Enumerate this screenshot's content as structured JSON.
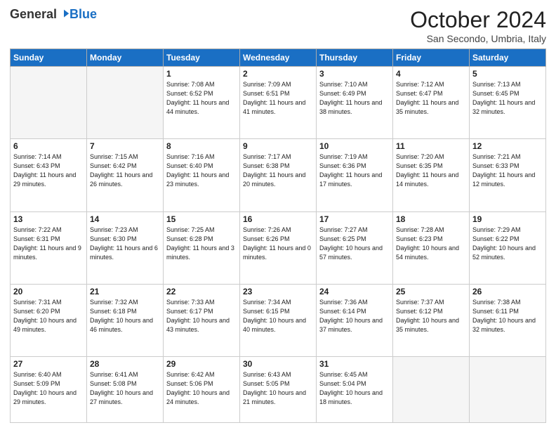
{
  "header": {
    "logo": {
      "general": "General",
      "blue": "Blue"
    },
    "title": "October 2024",
    "subtitle": "San Secondo, Umbria, Italy"
  },
  "weekdays": [
    "Sunday",
    "Monday",
    "Tuesday",
    "Wednesday",
    "Thursday",
    "Friday",
    "Saturday"
  ],
  "weeks": [
    [
      {
        "day": "",
        "info": ""
      },
      {
        "day": "",
        "info": ""
      },
      {
        "day": "1",
        "info": "Sunrise: 7:08 AM\nSunset: 6:52 PM\nDaylight: 11 hours and 44 minutes."
      },
      {
        "day": "2",
        "info": "Sunrise: 7:09 AM\nSunset: 6:51 PM\nDaylight: 11 hours and 41 minutes."
      },
      {
        "day": "3",
        "info": "Sunrise: 7:10 AM\nSunset: 6:49 PM\nDaylight: 11 hours and 38 minutes."
      },
      {
        "day": "4",
        "info": "Sunrise: 7:12 AM\nSunset: 6:47 PM\nDaylight: 11 hours and 35 minutes."
      },
      {
        "day": "5",
        "info": "Sunrise: 7:13 AM\nSunset: 6:45 PM\nDaylight: 11 hours and 32 minutes."
      }
    ],
    [
      {
        "day": "6",
        "info": "Sunrise: 7:14 AM\nSunset: 6:43 PM\nDaylight: 11 hours and 29 minutes."
      },
      {
        "day": "7",
        "info": "Sunrise: 7:15 AM\nSunset: 6:42 PM\nDaylight: 11 hours and 26 minutes."
      },
      {
        "day": "8",
        "info": "Sunrise: 7:16 AM\nSunset: 6:40 PM\nDaylight: 11 hours and 23 minutes."
      },
      {
        "day": "9",
        "info": "Sunrise: 7:17 AM\nSunset: 6:38 PM\nDaylight: 11 hours and 20 minutes."
      },
      {
        "day": "10",
        "info": "Sunrise: 7:19 AM\nSunset: 6:36 PM\nDaylight: 11 hours and 17 minutes."
      },
      {
        "day": "11",
        "info": "Sunrise: 7:20 AM\nSunset: 6:35 PM\nDaylight: 11 hours and 14 minutes."
      },
      {
        "day": "12",
        "info": "Sunrise: 7:21 AM\nSunset: 6:33 PM\nDaylight: 11 hours and 12 minutes."
      }
    ],
    [
      {
        "day": "13",
        "info": "Sunrise: 7:22 AM\nSunset: 6:31 PM\nDaylight: 11 hours and 9 minutes."
      },
      {
        "day": "14",
        "info": "Sunrise: 7:23 AM\nSunset: 6:30 PM\nDaylight: 11 hours and 6 minutes."
      },
      {
        "day": "15",
        "info": "Sunrise: 7:25 AM\nSunset: 6:28 PM\nDaylight: 11 hours and 3 minutes."
      },
      {
        "day": "16",
        "info": "Sunrise: 7:26 AM\nSunset: 6:26 PM\nDaylight: 11 hours and 0 minutes."
      },
      {
        "day": "17",
        "info": "Sunrise: 7:27 AM\nSunset: 6:25 PM\nDaylight: 10 hours and 57 minutes."
      },
      {
        "day": "18",
        "info": "Sunrise: 7:28 AM\nSunset: 6:23 PM\nDaylight: 10 hours and 54 minutes."
      },
      {
        "day": "19",
        "info": "Sunrise: 7:29 AM\nSunset: 6:22 PM\nDaylight: 10 hours and 52 minutes."
      }
    ],
    [
      {
        "day": "20",
        "info": "Sunrise: 7:31 AM\nSunset: 6:20 PM\nDaylight: 10 hours and 49 minutes."
      },
      {
        "day": "21",
        "info": "Sunrise: 7:32 AM\nSunset: 6:18 PM\nDaylight: 10 hours and 46 minutes."
      },
      {
        "day": "22",
        "info": "Sunrise: 7:33 AM\nSunset: 6:17 PM\nDaylight: 10 hours and 43 minutes."
      },
      {
        "day": "23",
        "info": "Sunrise: 7:34 AM\nSunset: 6:15 PM\nDaylight: 10 hours and 40 minutes."
      },
      {
        "day": "24",
        "info": "Sunrise: 7:36 AM\nSunset: 6:14 PM\nDaylight: 10 hours and 37 minutes."
      },
      {
        "day": "25",
        "info": "Sunrise: 7:37 AM\nSunset: 6:12 PM\nDaylight: 10 hours and 35 minutes."
      },
      {
        "day": "26",
        "info": "Sunrise: 7:38 AM\nSunset: 6:11 PM\nDaylight: 10 hours and 32 minutes."
      }
    ],
    [
      {
        "day": "27",
        "info": "Sunrise: 6:40 AM\nSunset: 5:09 PM\nDaylight: 10 hours and 29 minutes."
      },
      {
        "day": "28",
        "info": "Sunrise: 6:41 AM\nSunset: 5:08 PM\nDaylight: 10 hours and 27 minutes."
      },
      {
        "day": "29",
        "info": "Sunrise: 6:42 AM\nSunset: 5:06 PM\nDaylight: 10 hours and 24 minutes."
      },
      {
        "day": "30",
        "info": "Sunrise: 6:43 AM\nSunset: 5:05 PM\nDaylight: 10 hours and 21 minutes."
      },
      {
        "day": "31",
        "info": "Sunrise: 6:45 AM\nSunset: 5:04 PM\nDaylight: 10 hours and 18 minutes."
      },
      {
        "day": "",
        "info": ""
      },
      {
        "day": "",
        "info": ""
      }
    ]
  ]
}
